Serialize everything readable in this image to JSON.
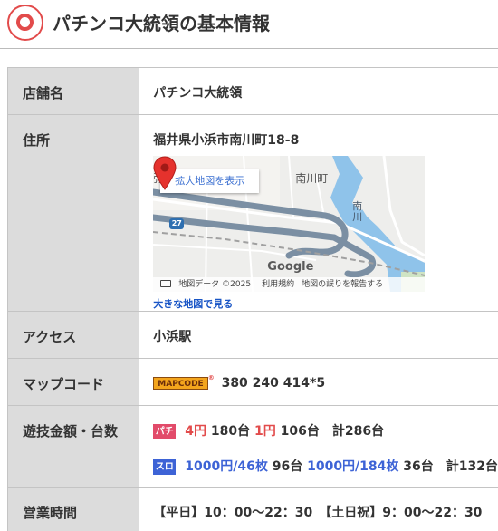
{
  "title": "パチンコ大統領の基本情報",
  "rows": {
    "store": {
      "label": "店舗名",
      "value": "パチンコ大統領"
    },
    "address": {
      "label": "住所",
      "value": "福井県小浜市南川町18-8",
      "map": {
        "expand_label": "拡大地図を表示",
        "route_badge": "27",
        "place_label": "南川町",
        "river_label": "南川",
        "edge_label": "弥",
        "attribution": "地図データ ©2025",
        "terms": "利用規約",
        "report": "地図の誤りを報告する",
        "google": "Google"
      },
      "big_map_link": "大きな地図で見る"
    },
    "access": {
      "label": "アクセス",
      "value": "小浜駅"
    },
    "mapcode": {
      "label": "マップコード",
      "logo": "MAPCODE",
      "reg": "®",
      "value": "380 240 414*5"
    },
    "rates": {
      "label": "遊技金額・台数",
      "pachi": {
        "badge": "パチ",
        "r1": "4円",
        "c1": "180台",
        "r2": "1円",
        "c2": "106台",
        "total": "計286台"
      },
      "slot": {
        "badge": "スロ",
        "r1": "1000円/46枚",
        "c1": "96台",
        "r2": "1000円/184枚",
        "c2": "36台",
        "total": "計132台"
      }
    },
    "hours": {
      "label": "営業時間",
      "weekday": "【平日】10：00〜22：30",
      "holiday": "【土日祝】9：00〜22：30"
    }
  },
  "colors": {
    "accent": "#e24b4b",
    "pachi": "#e24b6a",
    "slot": "#3d63d6",
    "link": "#1a56c6"
  }
}
